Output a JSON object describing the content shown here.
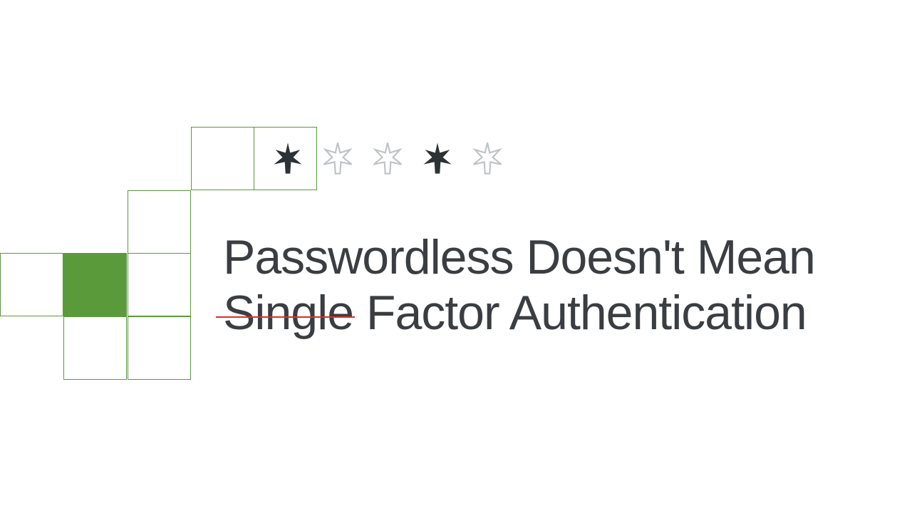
{
  "colors": {
    "green": "#5a9a3a",
    "dark": "#2c3236",
    "text": "#3a3e42",
    "strike": "#d93025"
  },
  "asterisks": [
    {
      "style": "filled"
    },
    {
      "style": "outline"
    },
    {
      "style": "outline"
    },
    {
      "style": "filled"
    },
    {
      "style": "outline"
    }
  ],
  "headline": {
    "line1": "Passwordless Doesn't Mean",
    "line2_struck": "Single",
    "line2_rest": " Factor Authentication"
  }
}
